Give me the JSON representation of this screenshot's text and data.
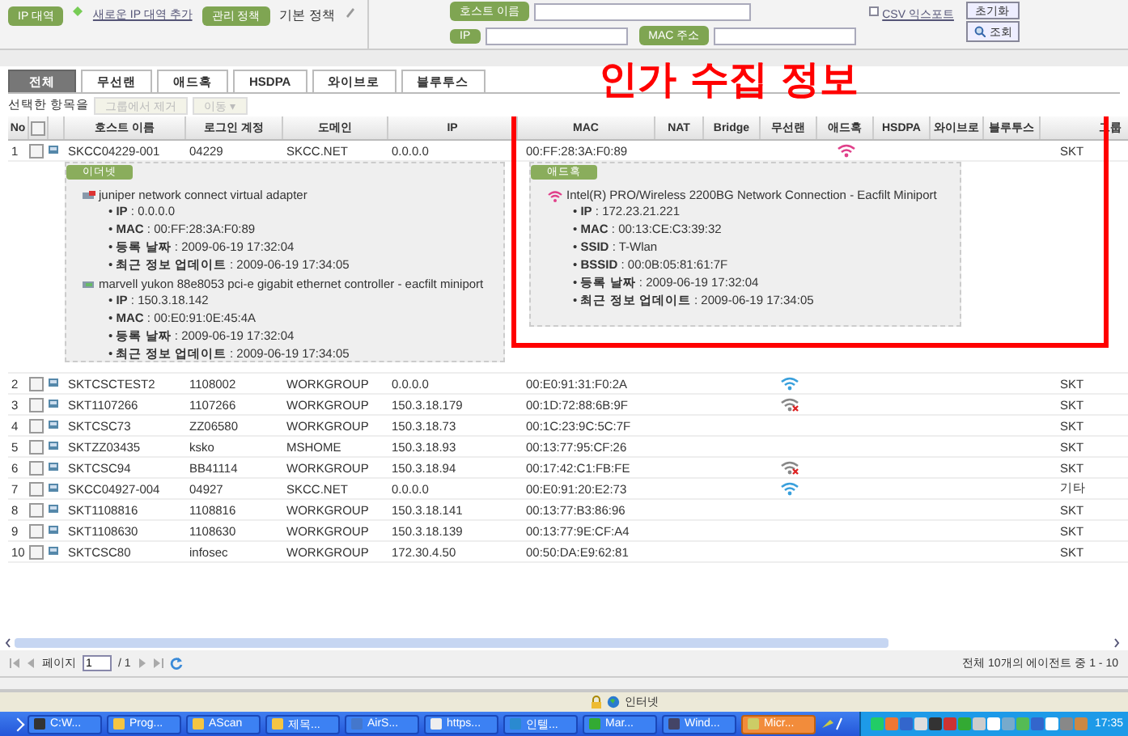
{
  "toolbar": {
    "ip_range_label": "IP 대역",
    "add_ip_range_link": "새로운 IP 대역 추가",
    "policy_label": "관리 정책",
    "policy_value": "기본 정책",
    "hostname_label": "호스트 이름",
    "ip_label": "IP",
    "mac_label": "MAC 주소",
    "csv_export_link": "CSV 익스포트",
    "reset_button": "초기화",
    "search_button": "조회"
  },
  "annotation": {
    "title": "인가 수집 정보"
  },
  "tabs": [
    {
      "label": "전체",
      "selected": true
    },
    {
      "label": "무선랜",
      "selected": false
    },
    {
      "label": "애드혹",
      "selected": false
    },
    {
      "label": "HSDPA",
      "selected": false
    },
    {
      "label": "와이브로",
      "selected": false
    },
    {
      "label": "블루투스",
      "selected": false
    }
  ],
  "actions": {
    "label": "선택한 항목을",
    "remove_button": {
      "label": "그룹에서 제거",
      "disabled": true
    },
    "move_dropdown": {
      "label": "이동 ▾",
      "disabled": true
    }
  },
  "table": {
    "columns": [
      "No",
      "호스트 이름",
      "로그인 계정",
      "도메인",
      "IP",
      "MAC",
      "NAT",
      "Bridge",
      "무선랜",
      "애드혹",
      "HSDPA",
      "와이브로",
      "블루투스",
      "그룹"
    ],
    "all_checked": false,
    "rows": [
      {
        "no": "1",
        "host": "SKCC04229-001",
        "login": "04229",
        "domain": "SKCC.NET",
        "ip": "0.0.0.0",
        "mac": "00:FF:28:3A:F0:89",
        "wifi": false,
        "adhoc": true,
        "group": "SKT",
        "checked": false,
        "details": [
          {
            "badge": "이더넷",
            "adapters": [
              {
                "kind": "ethernet-alert",
                "name": "juniper network connect virtual adapter",
                "fields": [
                  "• **IP** : 0.0.0.0",
                  "• **MAC** : 00:FF:28:3A:F0:89",
                  "• **등록 날짜** : 2009-06-19 17:32:04",
                  "• **최근 정보 업데이트** : 2009-06-19 17:34:05"
                ]
              },
              {
                "kind": "ethernet",
                "name": "marvell yukon 88e8053 pci-e gigabit ethernet controller - eacfilt miniport",
                "fields": [
                  "• **IP** : 150.3.18.142",
                  "• **MAC** : 00:E0:91:0E:45:4A",
                  "• **등록 날짜** : 2009-06-19 17:32:04",
                  "• **최근 정보 업데이트** : 2009-06-19 17:34:05"
                ]
              }
            ]
          },
          {
            "badge": "애드혹",
            "adapters": [
              {
                "kind": "wifi",
                "name": "Intel(R) PRO/Wireless 2200BG Network Connection - Eacfilt Miniport",
                "fields": [
                  "• **IP** : 172.23.21.221",
                  "• **MAC** : 00:13:CE:C3:39:32",
                  "• **SSID** : T-Wlan",
                  "• **BSSID** : 00:0B:05:81:61:7F",
                  "• **등록 날짜** : 2009-06-19 17:32:04",
                  "• **최근 정보 업데이트** : 2009-06-19 17:34:05"
                ]
              }
            ]
          }
        ]
      },
      {
        "no": "2",
        "host": "SKTCSCTEST2",
        "login": "1108002",
        "domain": "WORKGROUP",
        "ip": "0.0.0.0",
        "mac": "00:E0:91:31:F0:2A",
        "wifi": true,
        "wifi_connected": true,
        "adhoc": false,
        "group": "SKT",
        "checked": false
      },
      {
        "no": "3",
        "host": "SKT1107266",
        "login": "1107266",
        "domain": "WORKGROUP",
        "ip": "150.3.18.179",
        "mac": "00:1D:72:88:6B:9F",
        "wifi": true,
        "wifi_connected": false,
        "adhoc": false,
        "group": "SKT",
        "checked": false
      },
      {
        "no": "4",
        "host": "SKTCSC73",
        "login": "ZZ06580",
        "domain": "WORKGROUP",
        "ip": "150.3.18.73",
        "mac": "00:1C:23:9C:5C:7F",
        "wifi": false,
        "adhoc": false,
        "group": "SKT",
        "checked": false
      },
      {
        "no": "5",
        "host": "SKTZZ03435",
        "login": "ksko",
        "domain": "MSHOME",
        "ip": "150.3.18.93",
        "mac": "00:13:77:95:CF:26",
        "wifi": false,
        "adhoc": false,
        "group": "SKT",
        "checked": false
      },
      {
        "no": "6",
        "host": "SKTCSC94",
        "login": "BB41114",
        "domain": "WORKGROUP",
        "ip": "150.3.18.94",
        "mac": "00:17:42:C1:FB:FE",
        "wifi": true,
        "wifi_connected": false,
        "adhoc": false,
        "group": "SKT",
        "checked": false
      },
      {
        "no": "7",
        "host": "SKCC04927-004",
        "login": "04927",
        "domain": "SKCC.NET",
        "ip": "0.0.0.0",
        "mac": "00:E0:91:20:E2:73",
        "wifi": true,
        "wifi_connected": true,
        "adhoc": false,
        "group": "기타",
        "checked": false
      },
      {
        "no": "8",
        "host": "SKT1108816",
        "login": "1108816",
        "domain": "WORKGROUP",
        "ip": "150.3.18.141",
        "mac": "00:13:77:B3:86:96",
        "wifi": false,
        "adhoc": false,
        "group": "SKT",
        "checked": false
      },
      {
        "no": "9",
        "host": "SKT1108630",
        "login": "1108630",
        "domain": "WORKGROUP",
        "ip": "150.3.18.139",
        "mac": "00:13:77:9E:CF:A4",
        "wifi": false,
        "adhoc": false,
        "group": "SKT",
        "checked": false
      },
      {
        "no": "10",
        "host": "SKTCSC80",
        "login": "infosec",
        "domain": "WORKGROUP",
        "ip": "172.30.4.50",
        "mac": "00:50:DA:E9:62:81",
        "wifi": false,
        "adhoc": false,
        "group": "SKT",
        "checked": false
      }
    ]
  },
  "pager": {
    "page_label": "페이지",
    "page_value": "1",
    "page_total": "/ 1",
    "summary": "전체 10개의 에이전트 중 1 - 10"
  },
  "status_bar": {
    "zone": "인터넷"
  },
  "taskbar": {
    "items": [
      {
        "label": "C:W...",
        "selected": false
      },
      {
        "label": "Prog...",
        "selected": false
      },
      {
        "label": "AScan",
        "selected": false
      },
      {
        "label": "제목...",
        "selected": false
      },
      {
        "label": "AirS...",
        "selected": false
      },
      {
        "label": "https...",
        "selected": false
      },
      {
        "label": "인텔...",
        "selected": false
      },
      {
        "label": "Mar...",
        "selected": false
      },
      {
        "label": "Wind...",
        "selected": false
      },
      {
        "label": "Micr...",
        "selected": true
      }
    ],
    "clock": "17:35"
  }
}
